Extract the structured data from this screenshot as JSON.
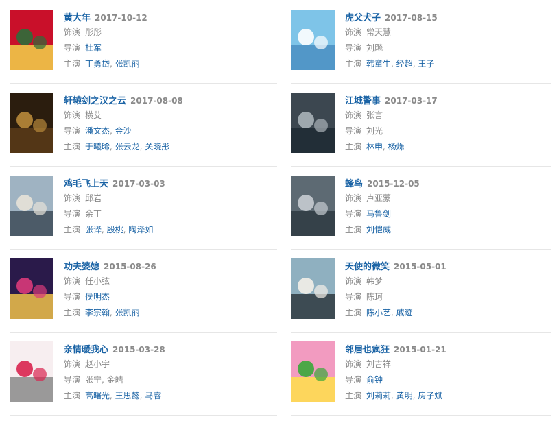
{
  "labels": {
    "role": "饰演",
    "director": "导演",
    "cast": "主演"
  },
  "movies": [
    {
      "title": "黄大年",
      "date": "2017-10-12",
      "role": "彤彤",
      "role_link": false,
      "director": [
        "杜军"
      ],
      "director_link": true,
      "cast": [
        "丁勇岱",
        "张凯丽"
      ],
      "cast_link": true,
      "poster_colors": [
        "#c9102a",
        "#2c6e3a",
        "#f2d24a"
      ]
    },
    {
      "title": "虎父犬子",
      "date": "2017-08-15",
      "role": "常天慧",
      "role_link": false,
      "director": [
        "刘飚"
      ],
      "director_link": false,
      "cast": [
        "韩童生",
        "经超",
        "王子"
      ],
      "cast_link": true,
      "poster_colors": [
        "#7ec4e8",
        "#ffffff",
        "#4a8fc2"
      ]
    },
    {
      "title": "轩辕剑之汉之云",
      "date": "2017-08-08",
      "role": "横艾",
      "role_link": false,
      "director": [
        "潘文杰",
        "金沙"
      ],
      "director_link": true,
      "cast": [
        "于曦晞",
        "张云龙",
        "关晓彤"
      ],
      "cast_link": true,
      "poster_colors": [
        "#2b1d0e",
        "#b8893a",
        "#5a3b18"
      ]
    },
    {
      "title": "江城警事",
      "date": "2017-03-17",
      "role": "张言",
      "role_link": false,
      "director": [
        "刘光"
      ],
      "director_link": false,
      "cast": [
        "林申",
        "杨烁"
      ],
      "cast_link": true,
      "poster_colors": [
        "#3c4750",
        "#a9b2b8",
        "#1d2a33"
      ]
    },
    {
      "title": "鸡毛飞上天",
      "date": "2017-03-03",
      "role": "邱岩",
      "role_link": false,
      "director": [
        "余丁"
      ],
      "director_link": false,
      "cast": [
        "张译",
        "殷桃",
        "陶泽如"
      ],
      "cast_link": true,
      "poster_colors": [
        "#9fb3c2",
        "#e7e2d8",
        "#3d4b58"
      ]
    },
    {
      "title": "蜂鸟",
      "date": "2015-12-05",
      "role": "卢亚蒙",
      "role_link": false,
      "director": [
        "马鲁剑"
      ],
      "director_link": true,
      "cast": [
        "刘恺威"
      ],
      "cast_link": true,
      "poster_colors": [
        "#5d6a73",
        "#c6ccd1",
        "#2e3942"
      ]
    },
    {
      "title": "功夫婆媳",
      "date": "2015-08-26",
      "role": "任小弦",
      "role_link": false,
      "director": [
        "侯明杰"
      ],
      "director_link": true,
      "cast": [
        "李宗翰",
        "张凯丽"
      ],
      "cast_link": true,
      "poster_colors": [
        "#2a1a4a",
        "#d93a7a",
        "#f0c24a"
      ]
    },
    {
      "title": "天使的微笑",
      "date": "2015-05-01",
      "role": "韩梦",
      "role_link": false,
      "director": [
        "陈珂"
      ],
      "director_link": false,
      "cast": [
        "陈小艺",
        "戚迹"
      ],
      "cast_link": true,
      "poster_colors": [
        "#8fb0c0",
        "#f3f0e8",
        "#2f3a40"
      ]
    },
    {
      "title": "亲情暖我心",
      "date": "2015-03-28",
      "role": "赵小宇",
      "role_link": false,
      "director": [
        "张宁",
        "金皓"
      ],
      "director_link": false,
      "cast": [
        "高曙光",
        "王思懿",
        "马睿"
      ],
      "cast_link": true,
      "poster_colors": [
        "#f7eef0",
        "#d8234f",
        "#8a8a8a"
      ]
    },
    {
      "title": "邻居也疯狂",
      "date": "2015-01-21",
      "role": "刘吉祥",
      "role_link": false,
      "director": [
        "俞钟"
      ],
      "director_link": true,
      "cast": [
        "刘莉莉",
        "黄明",
        "房子斌"
      ],
      "cast_link": true,
      "poster_colors": [
        "#f29bc0",
        "#3aa83a",
        "#ffe14a"
      ]
    }
  ]
}
